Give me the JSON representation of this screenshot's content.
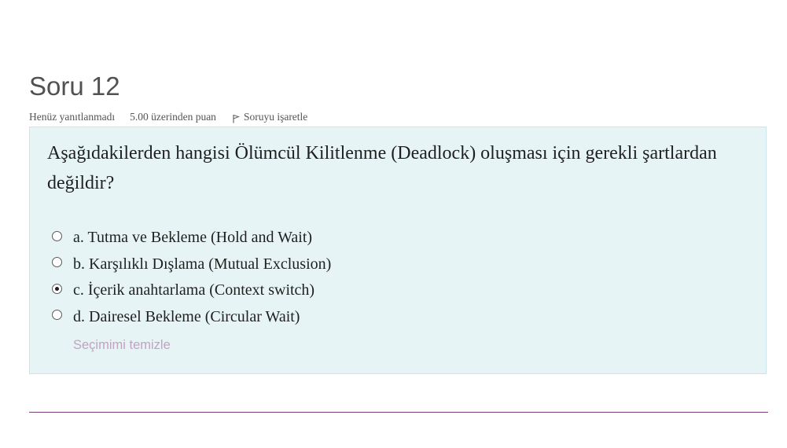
{
  "question": {
    "title": "Soru 12",
    "state": "Henüz yanıtlanmadı",
    "grade": "5.00 üzerinden puan",
    "flag_label": "Soruyu işaretle",
    "flag_icon": "flag-icon",
    "text": "Aşağıdakilerden hangisi Ölümcül Kilitlenme (Deadlock) oluşması için gerekli şartlardan değildir?",
    "answers": [
      {
        "label": "a. Tutma ve Bekleme (Hold and Wait)",
        "selected": false
      },
      {
        "label": "b. Karşılıklı Dışlama (Mutual Exclusion)",
        "selected": false
      },
      {
        "label": "c. İçerik anahtarlama (Context switch)",
        "selected": true
      },
      {
        "label": "d. Dairesel Bekleme (Circular Wait)",
        "selected": false
      }
    ],
    "clear_label": "Seçimimi temizle"
  },
  "colors": {
    "formulation_bg": "#e7f4f6",
    "formulation_border": "#c9e6ea",
    "clear_link": "#c3a2c2",
    "rule": "#7b3f7d"
  }
}
